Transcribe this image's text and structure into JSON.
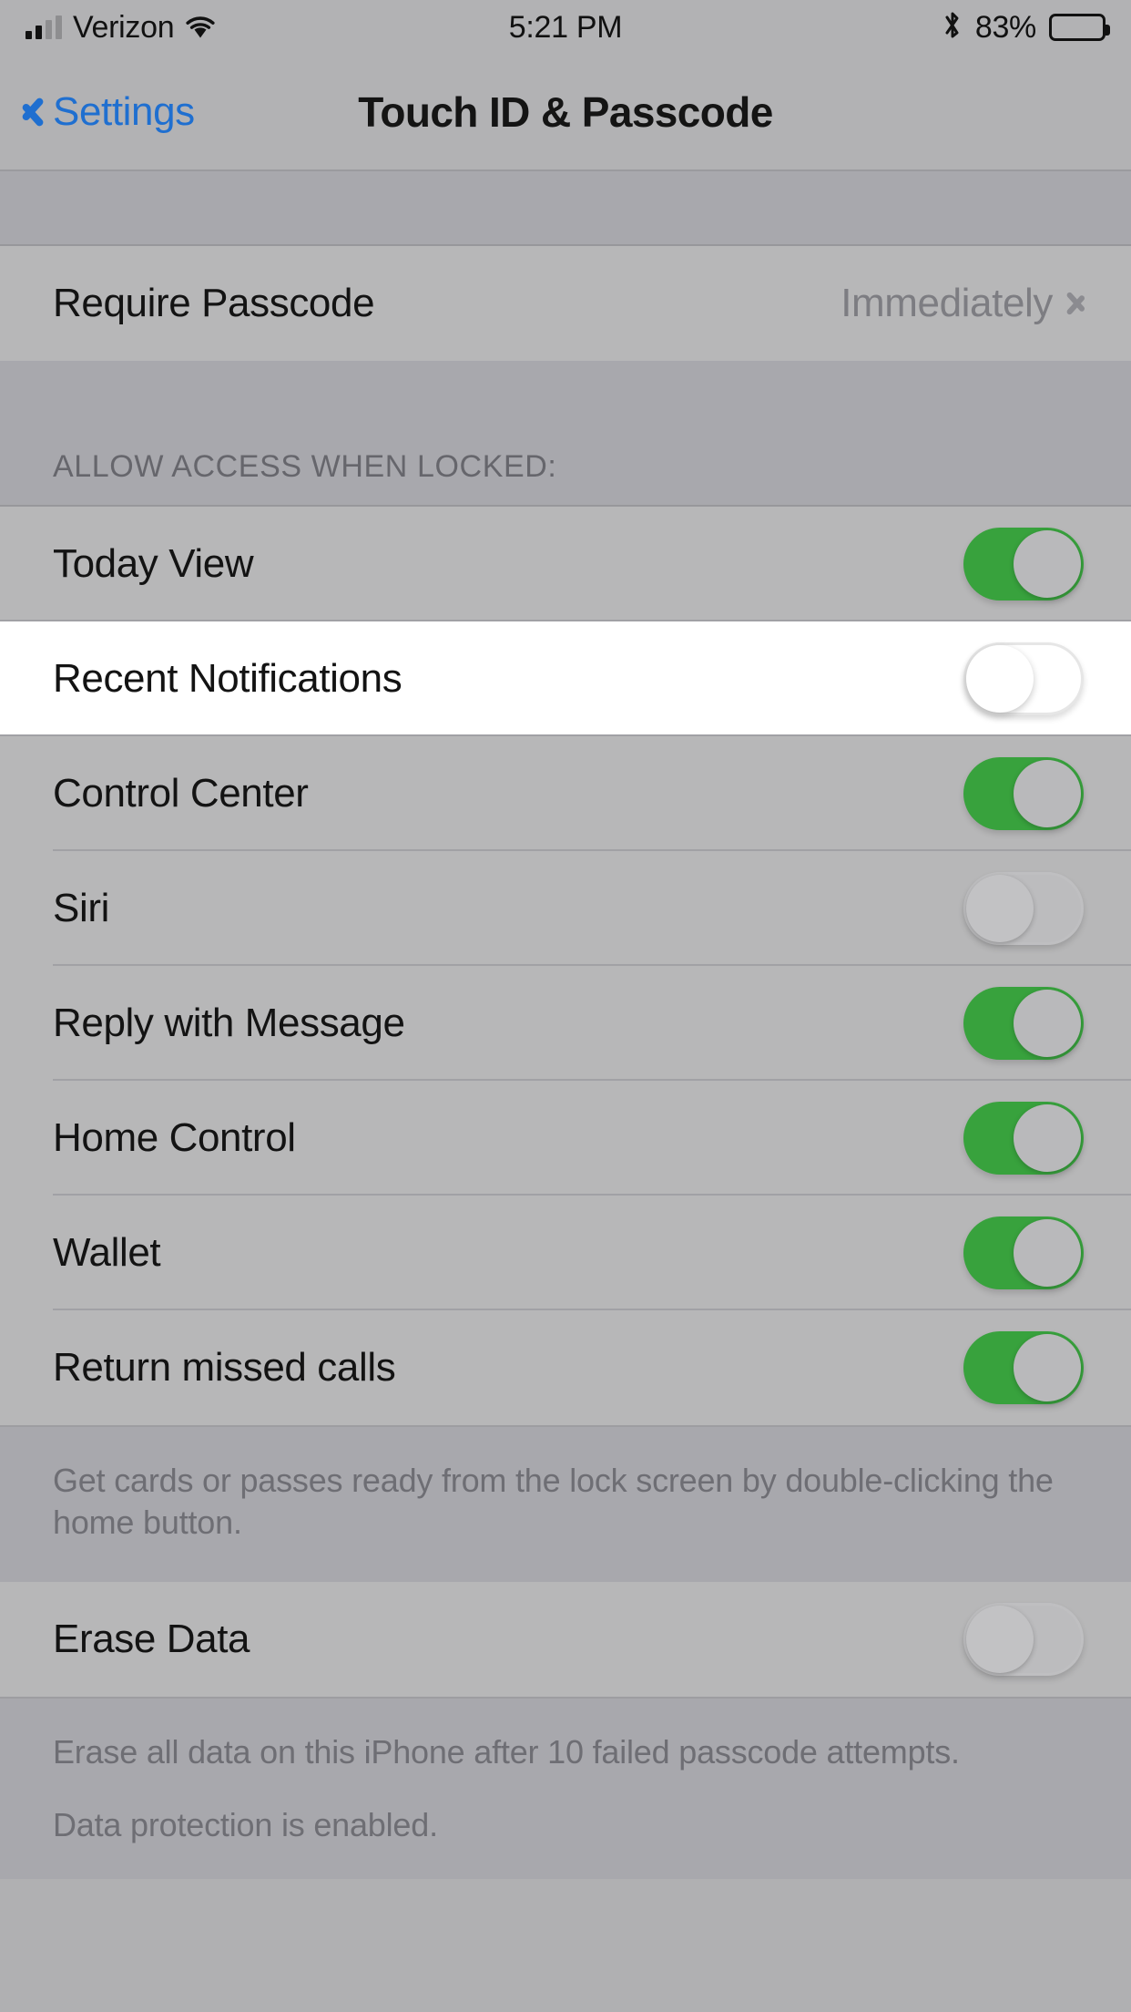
{
  "status_bar": {
    "carrier": "Verizon",
    "time": "5:21 PM",
    "battery_percent": "83%",
    "signal_icon": "cellular-signal-icon",
    "wifi_icon": "wifi-icon",
    "bluetooth_icon": "bluetooth-icon",
    "battery_icon": "battery-icon"
  },
  "nav": {
    "back_label": "Settings",
    "title": "Touch ID & Passcode",
    "back_icon": "chevron-left-icon",
    "accent_color": "#1f6fd0"
  },
  "require_passcode": {
    "label": "Require Passcode",
    "value": "Immediately",
    "disclosure_icon": "chevron-right-icon"
  },
  "allow_access": {
    "header": "ALLOW ACCESS WHEN LOCKED:",
    "rows": [
      {
        "label": "Today View",
        "state": "on",
        "highlighted": false
      },
      {
        "label": "Recent Notifications",
        "state": "off",
        "highlighted": true
      },
      {
        "label": "Control Center",
        "state": "on",
        "highlighted": false
      },
      {
        "label": "Siri",
        "state": "off",
        "highlighted": false
      },
      {
        "label": "Reply with Message",
        "state": "on",
        "highlighted": false
      },
      {
        "label": "Home Control",
        "state": "on",
        "highlighted": false
      },
      {
        "label": "Wallet",
        "state": "on",
        "highlighted": false
      },
      {
        "label": "Return missed calls",
        "state": "on",
        "highlighted": false
      }
    ],
    "footer": "Get cards or passes ready from the lock screen by double-clicking the home button."
  },
  "erase_data": {
    "label": "Erase Data",
    "state": "off",
    "footer_line_1": "Erase all data on this iPhone after 10 failed passcode attempts.",
    "footer_line_2": "Data protection is enabled."
  },
  "colors": {
    "switch_on": "#38a23d",
    "page_background": "#b0b0b2",
    "row_background": "#b7b7b8",
    "highlight_background": "#ffffff"
  }
}
